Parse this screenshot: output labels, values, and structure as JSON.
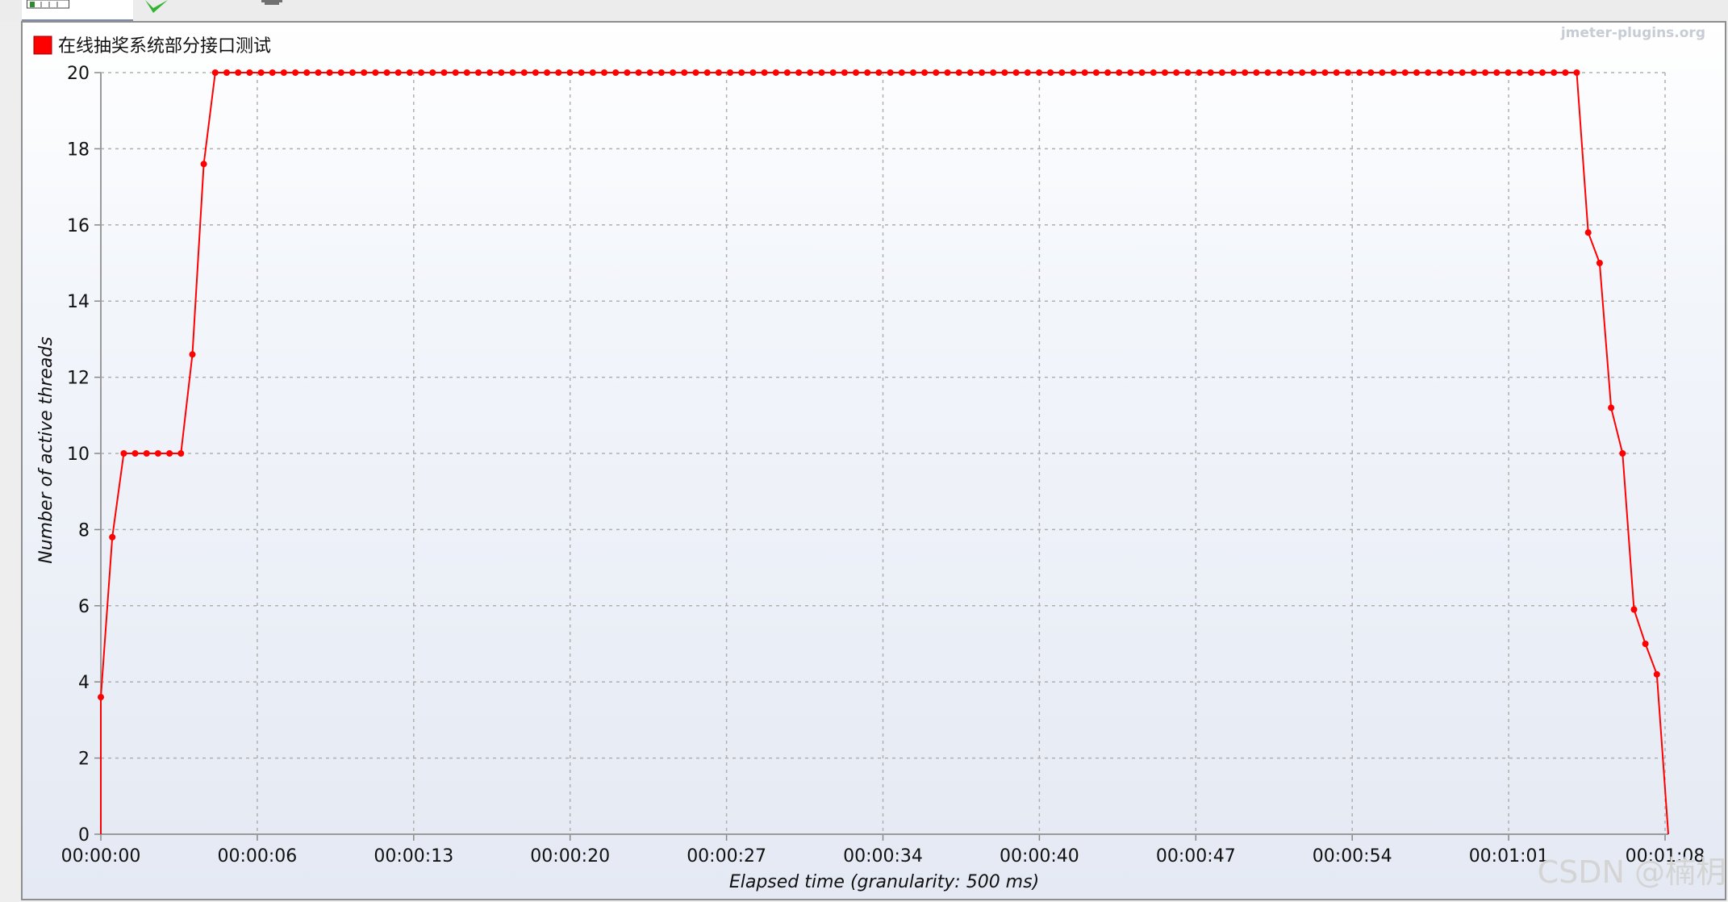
{
  "tabs": {
    "active_icon": "chart-tab-icon",
    "second_icon": "check-icon",
    "third_icon": "gear-icon"
  },
  "watermark_top": "jmeter-plugins.org",
  "watermark_bottom": "CSDN @楠枂",
  "colors": {
    "series": "#ff0000",
    "grid": "#b0b0b0",
    "frame": "#8e8e8e"
  },
  "chart_data": {
    "type": "line",
    "legend": [
      "在线抽奖系统部分接口测试"
    ],
    "legend_placement": "top-left",
    "xlabel": "Elapsed time (granularity: 500 ms)",
    "ylabel": "Number of active threads",
    "ylim": [
      0,
      20
    ],
    "yticks": [
      "0",
      "2",
      "4",
      "6",
      "8",
      "10",
      "12",
      "14",
      "16",
      "18",
      "20"
    ],
    "xticks": [
      "00:00:00",
      "00:00:06",
      "00:00:13",
      "00:00:20",
      "00:00:27",
      "00:00:34",
      "00:00:40",
      "00:00:47",
      "00:00:54",
      "00:01:01",
      "00:01:08"
    ],
    "xlim_seconds": [
      0,
      68.5
    ],
    "grid": true,
    "series": [
      {
        "name": "在线抽奖系统部分接口测试",
        "x": [
          0,
          0.5,
          1,
          1.5,
          2,
          2.5,
          3,
          3.5,
          4,
          4.5,
          5,
          5.5,
          6,
          6.5,
          7,
          7.5,
          8,
          8.5,
          9,
          9.5,
          10,
          10.5,
          11,
          11.5,
          12,
          12.5,
          13,
          13.5,
          14,
          14.5,
          15,
          15.5,
          16,
          16.5,
          17,
          17.5,
          18,
          18.5,
          19,
          19.5,
          20,
          20.5,
          21,
          21.5,
          22,
          22.5,
          23,
          23.5,
          24,
          24.5,
          25,
          25.5,
          26,
          26.5,
          27,
          27.5,
          28,
          28.5,
          29,
          29.5,
          30,
          30.5,
          31,
          31.5,
          32,
          32.5,
          33,
          33.5,
          34,
          34.5,
          35,
          35.5,
          36,
          36.5,
          37,
          37.5,
          38,
          38.5,
          39,
          39.5,
          40,
          40.5,
          41,
          41.5,
          42,
          42.5,
          43,
          43.5,
          44,
          44.5,
          45,
          45.5,
          46,
          46.5,
          47,
          47.5,
          48,
          48.5,
          49,
          49.5,
          50,
          50.5,
          51,
          51.5,
          52,
          52.5,
          53,
          53.5,
          54,
          54.5,
          55,
          55.5,
          56,
          56.5,
          57,
          57.5,
          58,
          58.5,
          59,
          59.5,
          60,
          60.5,
          61,
          61.5,
          62,
          62.5,
          63,
          63.5,
          64,
          64.5,
          65,
          65.5,
          66,
          66.5,
          67,
          67.5,
          68,
          68.5
        ],
        "y": [
          3.6,
          7.8,
          10,
          10,
          10,
          10,
          10,
          10,
          12.6,
          17.6,
          20,
          20,
          20,
          20,
          20,
          20,
          20,
          20,
          20,
          20,
          20,
          20,
          20,
          20,
          20,
          20,
          20,
          20,
          20,
          20,
          20,
          20,
          20,
          20,
          20,
          20,
          20,
          20,
          20,
          20,
          20,
          20,
          20,
          20,
          20,
          20,
          20,
          20,
          20,
          20,
          20,
          20,
          20,
          20,
          20,
          20,
          20,
          20,
          20,
          20,
          20,
          20,
          20,
          20,
          20,
          20,
          20,
          20,
          20,
          20,
          20,
          20,
          20,
          20,
          20,
          20,
          20,
          20,
          20,
          20,
          20,
          20,
          20,
          20,
          20,
          20,
          20,
          20,
          20,
          20,
          20,
          20,
          20,
          20,
          20,
          20,
          20,
          20,
          20,
          20,
          20,
          20,
          20,
          20,
          20,
          20,
          20,
          20,
          20,
          20,
          20,
          20,
          20,
          20,
          20,
          20,
          20,
          20,
          20,
          20,
          20,
          20,
          20,
          20,
          20,
          20,
          20,
          20,
          20,
          20,
          15.8,
          15,
          11.2,
          10,
          5.9,
          5,
          4.2,
          0
        ]
      }
    ]
  }
}
